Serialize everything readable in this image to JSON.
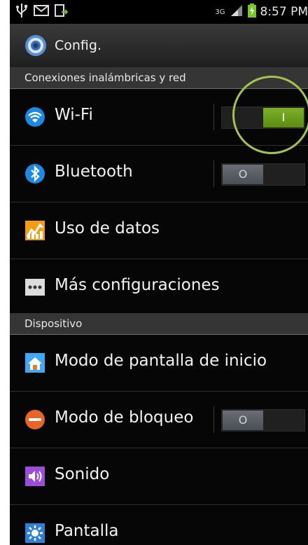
{
  "status_bar": {
    "time": "8:57 PM",
    "network_label": "3G",
    "icons": [
      "usb-icon",
      "gmail-icon",
      "upload-icon",
      "signal-icon",
      "battery-icon"
    ]
  },
  "action_bar": {
    "title": "Config.",
    "icon": "settings-icon"
  },
  "sections": [
    {
      "title": "Conexiones inalámbricas y red"
    },
    {
      "title": "Dispositivo"
    }
  ],
  "rows": [
    {
      "label": "Wi-Fi",
      "icon": "wifi-icon",
      "toggle": "on",
      "toggle_text": "I"
    },
    {
      "label": "Bluetooth",
      "icon": "bluetooth-icon",
      "toggle": "off",
      "toggle_text": "O"
    },
    {
      "label": "Uso de datos",
      "icon": "data-usage-icon"
    },
    {
      "label": "Más configuraciones",
      "icon": "more-icon"
    },
    {
      "label": "Modo de pantalla de inicio",
      "icon": "home-screen-icon"
    },
    {
      "label": "Modo de bloqueo",
      "icon": "block-mode-icon",
      "toggle": "off",
      "toggle_text": "O"
    },
    {
      "label": "Sonido",
      "icon": "sound-icon"
    },
    {
      "label": "Pantalla",
      "icon": "display-icon"
    }
  ],
  "colors": {
    "toggle_on": "#6a9c1a",
    "toggle_off": "#5b6066",
    "highlight": "#a4c24f"
  }
}
